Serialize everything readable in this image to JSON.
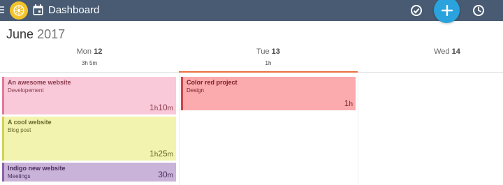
{
  "app": {
    "title": "Dashboard"
  },
  "calendar": {
    "month": "June",
    "year": "2017",
    "days": [
      {
        "name": "Mon",
        "num": "12",
        "total": "3h 5m",
        "active": false
      },
      {
        "name": "Tue",
        "num": "13",
        "total": "1h",
        "active": true
      },
      {
        "name": "Wed",
        "num": "14",
        "total": "",
        "active": false
      }
    ]
  },
  "events": [
    {
      "title": "An awesome website",
      "category": "Developement",
      "dur_h": "1",
      "dur_h_unit": "h",
      "dur_m": "10",
      "dur_m_unit": "m",
      "color": "#f9c9d9",
      "border": "#e07a9a",
      "text": "#8a3a4a"
    },
    {
      "title": "A cool website",
      "category": "Blog post",
      "dur_h": "1",
      "dur_h_unit": "h",
      "dur_m": "25",
      "dur_m_unit": "m",
      "color": "#f2f3ae",
      "border": "#d2d050",
      "text": "#66662a"
    },
    {
      "title": "Indigo new website",
      "category": "Meetings",
      "dur_h": "",
      "dur_h_unit": "",
      "dur_m": "30",
      "dur_m_unit": "m",
      "color": "#c9b3d9",
      "border": "#8a5fa8",
      "text": "#4a2d5e"
    },
    {
      "title": "Color red project",
      "category": "Design",
      "dur_h": "1",
      "dur_h_unit": "h",
      "dur_m": "",
      "dur_m_unit": "",
      "color": "#fbaaad",
      "border": "#d2424a",
      "text": "#7a2025"
    }
  ]
}
